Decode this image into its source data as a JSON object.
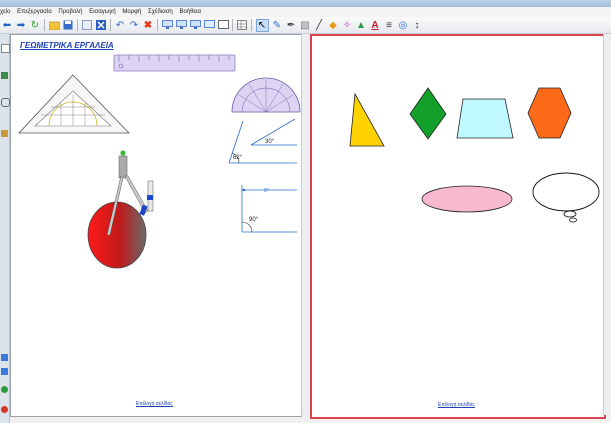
{
  "menu": [
    "χείο",
    "Επεξεργασία",
    "Προβολή",
    "Εισαγωγή",
    "Μορφή",
    "Σχέδιαση",
    "Βοήθεια"
  ],
  "toolbar_icons": [
    "arrow-left-icon",
    "arrow-right-icon",
    "refresh-icon",
    "open-folder-icon",
    "save-icon",
    "export-icon",
    "close-x-icon",
    "undo-icon",
    "redo-icon",
    "delete-icon",
    "screen-icon",
    "screen-icon",
    "screen-icon",
    "screen-icon",
    "board-icon",
    "table-icon",
    "select-arrow-icon",
    "pen-icon",
    "marker-icon",
    "eraser-icon",
    "line-icon",
    "fill-icon",
    "magic-icon",
    "shape-icon",
    "text-icon",
    "highlight-icon",
    "globe-icon",
    "more-icon"
  ],
  "left_page": {
    "title": "ΓΕΩΜΕΤΡΙΚΑ ΕΡΓΑΛΕΙΑ",
    "angle_labels": {
      "a62": "62°",
      "a30": "30°",
      "a0": "0°",
      "a90": "90°"
    },
    "footer_link": "Επίλογή σελίδας"
  },
  "right_page": {
    "footer_link": "Επίλογή σελίδας",
    "shapes": [
      {
        "name": "triangle",
        "color": "#ffd200"
      },
      {
        "name": "rhombus",
        "color": "#12a02a"
      },
      {
        "name": "trapezoid",
        "color": "#bff8ff"
      },
      {
        "name": "hexagon",
        "color": "#ff6a1a"
      },
      {
        "name": "ellipse",
        "color": "#f8b8cf"
      },
      {
        "name": "thought-bubble",
        "color": "#ffffff"
      }
    ]
  }
}
